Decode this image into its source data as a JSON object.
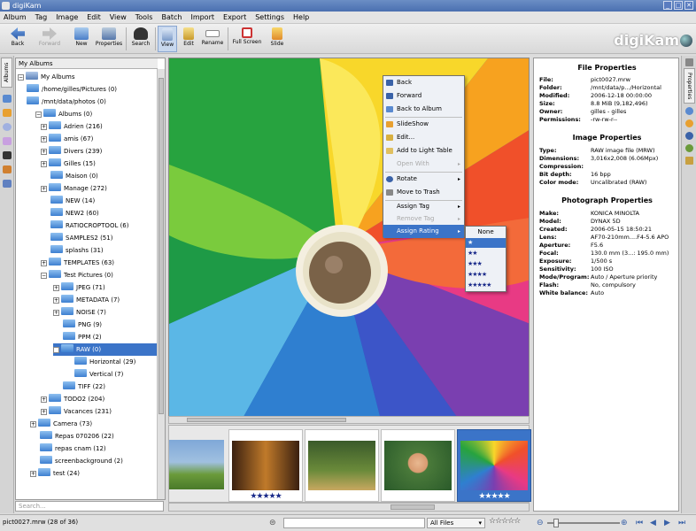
{
  "window": {
    "title": "digiKam",
    "controls": [
      "_",
      "□",
      "✕"
    ]
  },
  "menu": [
    "Album",
    "Tag",
    "Image",
    "Edit",
    "View",
    "Tools",
    "Batch",
    "Import",
    "Export",
    "Settings",
    "Help"
  ],
  "toolbar": {
    "back": "Back",
    "forward": "Forward",
    "new": "New",
    "properties": "Properties",
    "search": "Search",
    "view": "View",
    "edit": "Edit",
    "rename": "Rename",
    "fullscreen": "Full Screen",
    "slide": "Slide",
    "logo": "digiKam"
  },
  "left_tab": "Albums",
  "album_tree": {
    "header": "My Albums",
    "items": [
      {
        "label": "My Albums"
      },
      {
        "label": "/home/gilles/Pictures (0)"
      },
      {
        "label": "/mnt/data/photos (0)"
      },
      {
        "label": "Albums (0)"
      },
      {
        "label": "Adrien (216)"
      },
      {
        "label": "amis (67)"
      },
      {
        "label": "Divers (239)"
      },
      {
        "label": "Gilles (15)"
      },
      {
        "label": "Maison (0)"
      },
      {
        "label": "Manage (272)"
      },
      {
        "label": "NEW (14)"
      },
      {
        "label": "NEW2 (60)"
      },
      {
        "label": "RATIOCROPTOOL (6)"
      },
      {
        "label": "SAMPLES2 (51)"
      },
      {
        "label": "splashs (31)"
      },
      {
        "label": "TEMPLATES (63)"
      },
      {
        "label": "Test Pictures (0)"
      },
      {
        "label": "JPEG (71)"
      },
      {
        "label": "METADATA (7)"
      },
      {
        "label": "NOISE (7)"
      },
      {
        "label": "PNG (9)"
      },
      {
        "label": "PPM (2)"
      },
      {
        "label": "RAW (0)"
      },
      {
        "label": "Horizontal (29)"
      },
      {
        "label": "Vertical (7)"
      },
      {
        "label": "TIFF (22)"
      },
      {
        "label": "TODO2 (204)"
      },
      {
        "label": "Vacances (231)"
      },
      {
        "label": "Camera (73)"
      },
      {
        "label": "Repas 070206 (22)"
      },
      {
        "label": "repas cnam (12)"
      },
      {
        "label": "screenbackground (2)"
      },
      {
        "label": "test (24)"
      }
    ],
    "search_placeholder": "Search..."
  },
  "context_menu": {
    "items": [
      "Back",
      "Forward",
      "Back to Album",
      "SlideShow",
      "Edit...",
      "Add to Light Table",
      "Open With",
      "Rotate",
      "Move to Trash",
      "Assign Tag",
      "Remove Tag",
      "Assign Rating"
    ],
    "arrow": "▸"
  },
  "rating_submenu": [
    "None",
    "★",
    "★★",
    "★★★",
    "★★★★",
    "★★★★★"
  ],
  "thumbnails": {
    "stars": "★★★★★"
  },
  "properties": {
    "tab": "Properties",
    "file_title": "File Properties",
    "file": [
      {
        "k": "File:",
        "v": "pict0027.mrw"
      },
      {
        "k": "Folder:",
        "v": "/mnt/data/p.../Horizontal"
      },
      {
        "k": "Modified:",
        "v": "2006-12-18 00:00:00"
      },
      {
        "k": "Size:",
        "v": "8.8 MiB (9,182,496)"
      },
      {
        "k": "Owner:",
        "v": "gilles - gilles"
      },
      {
        "k": "Permissions:",
        "v": "-rw-rw-r--"
      }
    ],
    "image_title": "Image Properties",
    "image": [
      {
        "k": "Type:",
        "v": "RAW image file (MRW)"
      },
      {
        "k": "Dimensions:",
        "v": "3,016x2,008 (6.06Mpx)"
      },
      {
        "k": "Compression:",
        "v": ""
      },
      {
        "k": "Bit depth:",
        "v": "16 bpp"
      },
      {
        "k": "Color mode:",
        "v": "Uncalibrated (RAW)"
      }
    ],
    "photo_title": "Photograph Properties",
    "photo": [
      {
        "k": "Make:",
        "v": "KONICA MINOLTA"
      },
      {
        "k": "Model:",
        "v": "DYNAX 5D"
      },
      {
        "k": "Created:",
        "v": "2006-05-15 18:50:21"
      },
      {
        "k": "Lens:",
        "v": "AF70-210mm....F4-5.6 APO"
      },
      {
        "k": "Aperture:",
        "v": "F5.6"
      },
      {
        "k": "Focal:",
        "v": "130.0 mm (3...: 195.0 mm)"
      },
      {
        "k": "Exposure:",
        "v": "1/500 s"
      },
      {
        "k": "Sensitivity:",
        "v": "100 ISO"
      },
      {
        "k": "Mode/Program:",
        "v": "Auto / Aperture priority"
      },
      {
        "k": "Flash:",
        "v": "No, compulsory"
      },
      {
        "k": "White balance:",
        "v": "Auto"
      }
    ]
  },
  "status": {
    "text": "pict0027.mrw (28 of 36)",
    "file_filter": "All Files",
    "rating_filter": "☆☆☆☆☆"
  },
  "colors": {
    "accent": "#3b74c8",
    "titlebar": "#4a6fb0",
    "star": "#1a2a8a"
  }
}
